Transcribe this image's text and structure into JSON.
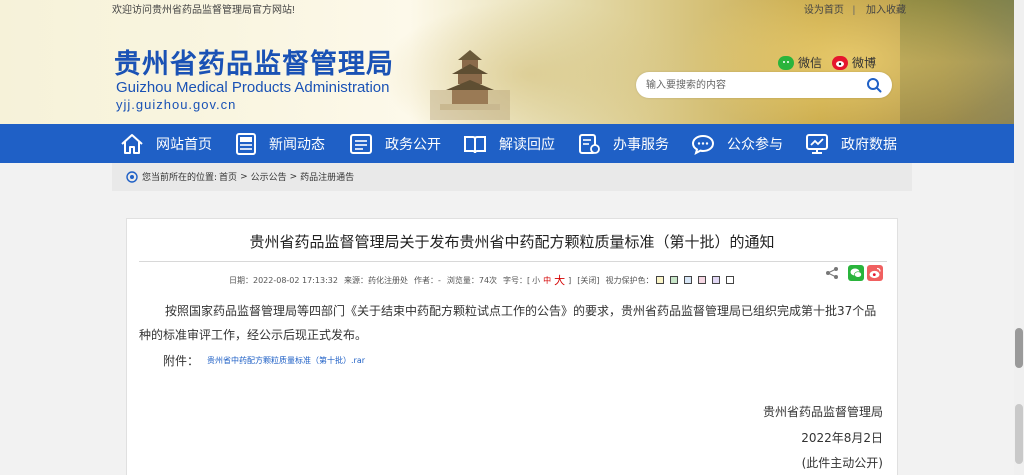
{
  "header": {
    "welcome": "欢迎访问贵州省药品监督管理局官方网站!",
    "top_links": [
      "设为首页",
      "加入收藏"
    ],
    "title_cn": "贵州省药品监督管理局",
    "title_en": "Guizhou Medical Products Administration",
    "url": "yjj.guizhou.gov.cn",
    "social": {
      "wechat": "微信",
      "weibo": "微博"
    },
    "search": {
      "placeholder": "输入要搜索的内容"
    }
  },
  "nav": {
    "items": [
      {
        "label": "网站首页",
        "icon": "home-icon"
      },
      {
        "label": "新闻动态",
        "icon": "news-icon"
      },
      {
        "label": "政务公开",
        "icon": "folder-icon"
      },
      {
        "label": "解读回应",
        "icon": "book-icon"
      },
      {
        "label": "办事服务",
        "icon": "service-icon"
      },
      {
        "label": "公众参与",
        "icon": "chat-icon"
      },
      {
        "label": "政府数据",
        "icon": "data-icon"
      }
    ]
  },
  "breadcrumb": {
    "prefix": "您当前所在的位置:",
    "items": [
      "首页",
      "公示公告",
      "药品注册通告"
    ],
    "separator": ">"
  },
  "article": {
    "title": "贵州省药品监督管理局关于发布贵州省中药配方颗粒质量标准（第十批）的通知",
    "meta": {
      "date": "日期：2022-08-02 17:13:32",
      "source": "来源：药化注册处",
      "author": "作者：-",
      "views": "浏览量：74次",
      "font_label": "字号：[",
      "font_small": "小",
      "font_mid": "中",
      "font_large": "大",
      "font_end": "]",
      "close": "[关闭]",
      "eye_label": "视力保护色：",
      "swatch_colors": [
        "#fbf5c8",
        "#c8e6c9",
        "#d7e6f7",
        "#f6d7e4",
        "#e1d7f4",
        "#ffffff"
      ]
    },
    "body": "按照国家药品监督管理局等四部门《关于结束中药配方颗粒试点工作的公告》的要求，贵州省药品监督管理局已组织完成第十批37个品种的标准审评工作，经公示后现正式发布。",
    "attachment_label": "附件：",
    "attachment_link": "贵州省中药配方颗粒质量标准（第十批）.rar",
    "signature": {
      "org": "贵州省药品监督管理局",
      "date": "2022年8月2日",
      "note": "(此件主动公开)"
    }
  }
}
